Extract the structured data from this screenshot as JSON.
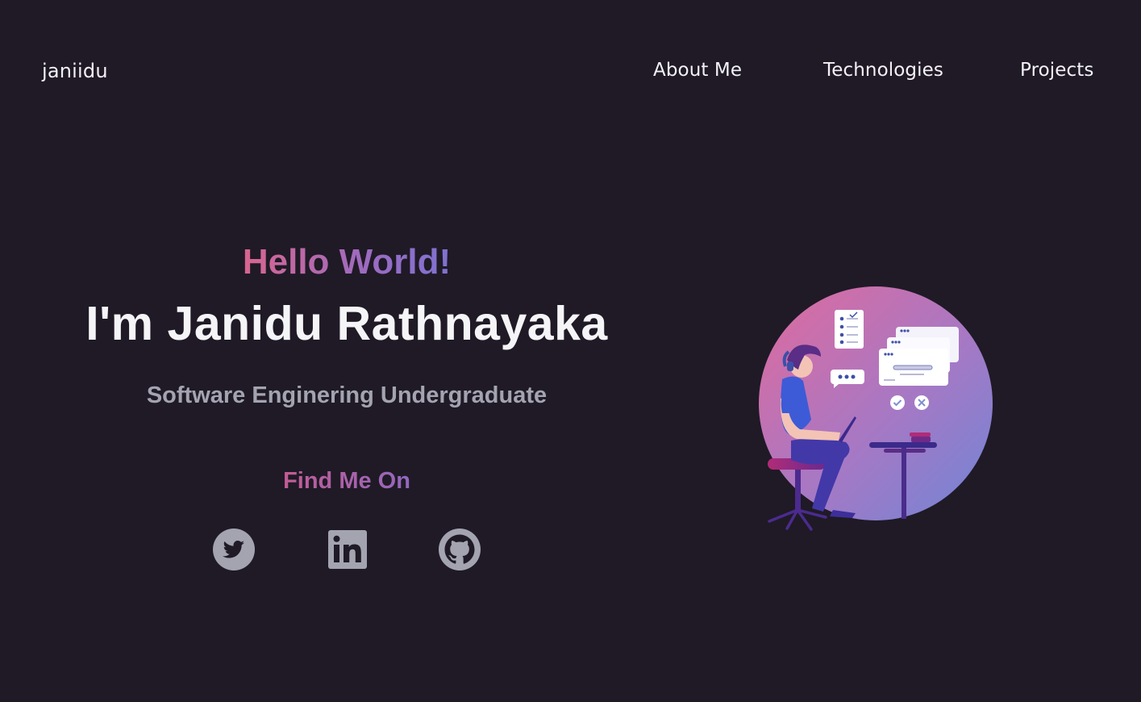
{
  "header": {
    "brand": "janiidu",
    "nav": [
      {
        "label": "About Me"
      },
      {
        "label": "Technologies"
      },
      {
        "label": "Projects"
      }
    ]
  },
  "hero": {
    "greeting": "Hello World!",
    "name": "I'm Janidu Rathnayaka",
    "role": "Software Enginering Undergraduate",
    "find_me": "Find Me On"
  },
  "socials": [
    {
      "icon": "twitter-icon"
    },
    {
      "icon": "linkedin-icon"
    },
    {
      "icon": "github-icon"
    }
  ],
  "colors": {
    "background": "#1f1a26",
    "text": "#f5f4f7",
    "muted": "#a3a4b0",
    "gradient_start": "#d9658f",
    "gradient_end": "#7f72d1"
  }
}
